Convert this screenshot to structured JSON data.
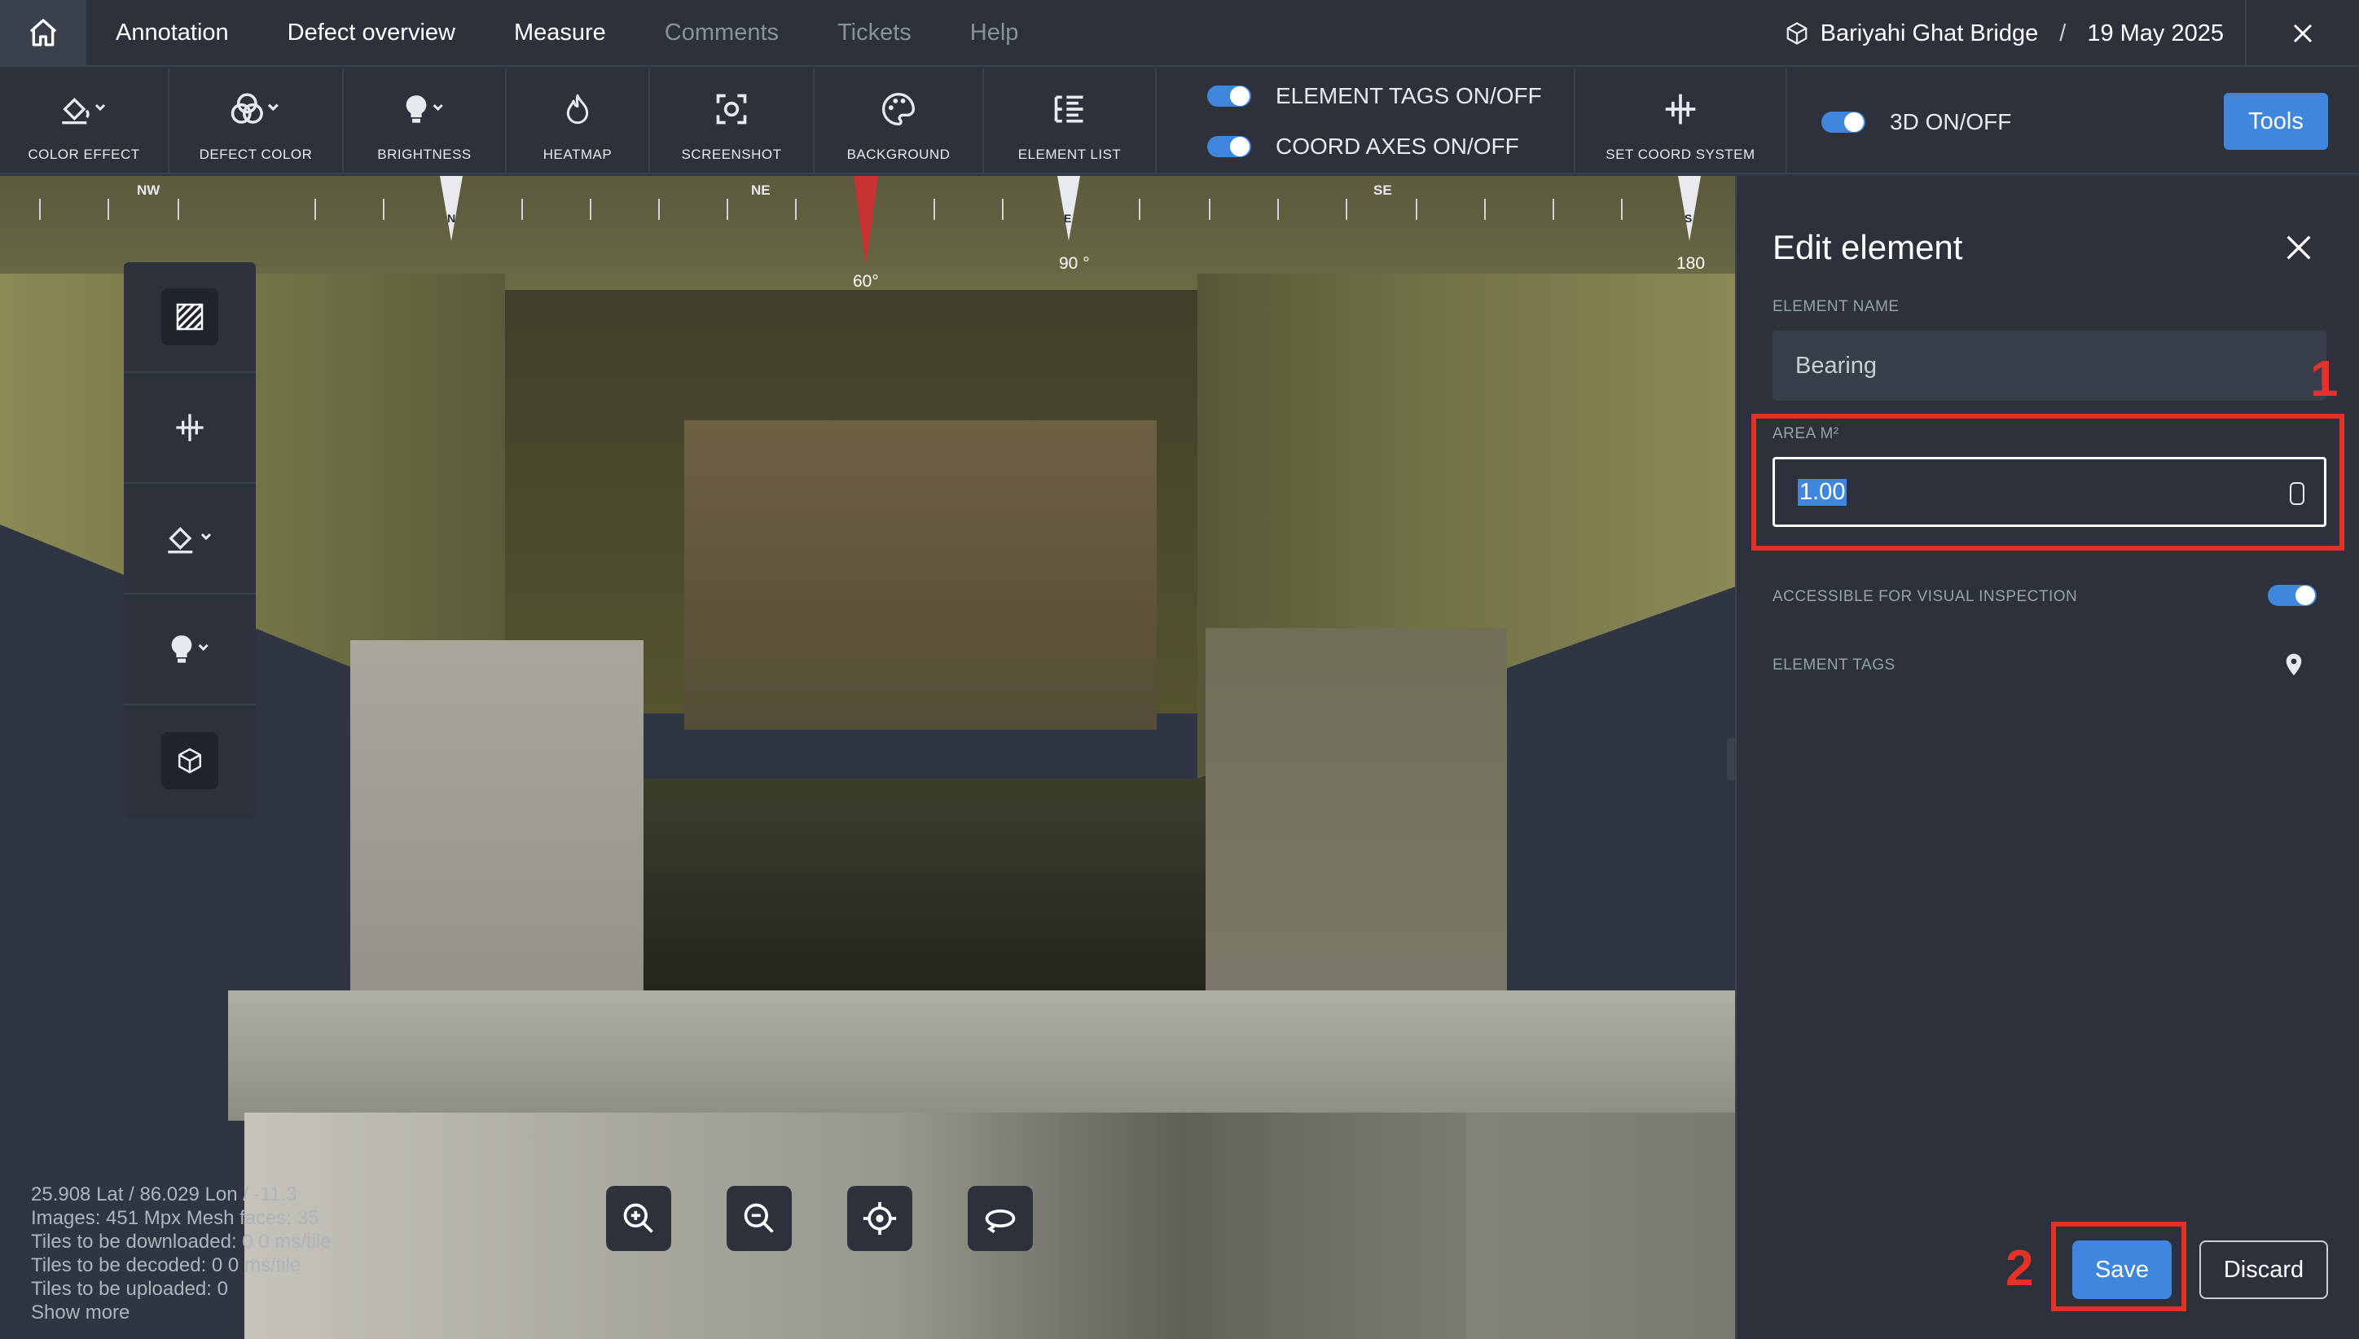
{
  "nav": {
    "tabs": [
      {
        "label": "Annotation"
      },
      {
        "label": "Defect overview"
      },
      {
        "label": "Measure"
      },
      {
        "label": "Comments"
      },
      {
        "label": "Tickets"
      },
      {
        "label": "Help"
      }
    ],
    "project_name": "Bariyahi Ghat Bridge",
    "separator": "/",
    "date": "19 May 2025"
  },
  "toolbar": {
    "color_effect": "COLOR EFFECT",
    "defect_color": "DEFECT COLOR",
    "brightness": "BRIGHTNESS",
    "heatmap": "HEATMAP",
    "screenshot": "SCREENSHOT",
    "background": "BACKGROUND",
    "element_list": "ELEMENT LIST",
    "element_tags_toggle": "ELEMENT TAGS ON/OFF",
    "coord_axes_toggle": "COORD AXES ON/OFF",
    "set_coord_system": "SET COORD SYSTEM",
    "three_d_toggle": "3D ON/OFF",
    "tools_button": "Tools"
  },
  "compass": {
    "cardinals": [
      "NW",
      "N",
      "NE",
      "E",
      "SE",
      "S"
    ],
    "heading_label": "60°",
    "east_label": "90 °",
    "south_label": "180"
  },
  "viewport_stats": {
    "lines": [
      "25.908 Lat / 86.029 Lon / -11.3",
      "Images: 451 Mpx    Mesh faces: 35",
      "Tiles to be downloaded: 0    0 ms/tile",
      "Tiles to be decoded: 0    0 ms/tile",
      "Tiles to be uploaded: 0",
      "Show more"
    ]
  },
  "edit_panel": {
    "title": "Edit element",
    "element_name_label": "ELEMENT NAME",
    "element_name_value": "Bearing",
    "area_label": "AREA M²",
    "area_value": "1.00",
    "accessible_label": "ACCESSIBLE FOR VISUAL INSPECTION",
    "accessible_on": true,
    "element_tags_label": "ELEMENT TAGS",
    "save_label": "Save",
    "discard_label": "Discard"
  },
  "annotations": {
    "step1": "1",
    "step2": "2"
  },
  "colors": {
    "accent": "#3f86de",
    "highlight": "#e53228",
    "panel_bg": "#2c313c"
  }
}
